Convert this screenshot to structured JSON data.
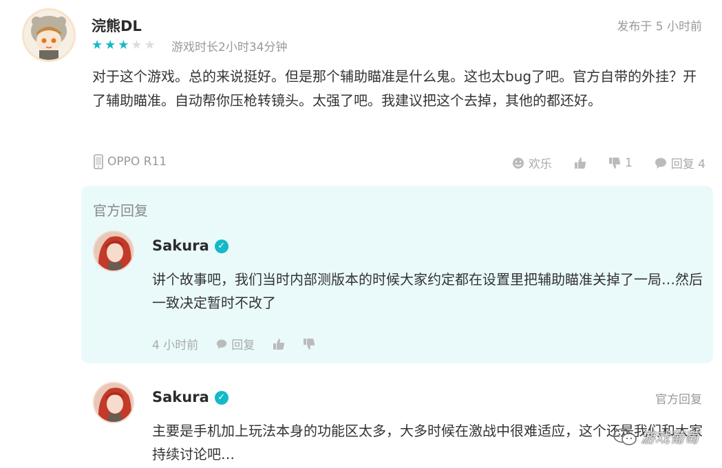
{
  "review": {
    "username": "浣熊DL",
    "rating": 3,
    "max_rating": 5,
    "playtime": "游戏时长2小时34分钟",
    "posted": "发布于 5 小时前",
    "text": "对于这个游戏。总的来说挺好。但是那个辅助瞄准是什么鬼。这也太bug了吧。官方自带的外挂？开了辅助瞄准。自动帮你压枪转镜头。太强了吧。我建议把这个去掉，其他的都还好。",
    "device": "OPPO R11",
    "actions": {
      "funny_label": "欢乐",
      "dislike_count": "1",
      "reply_label": "回复 4"
    }
  },
  "official_reply": {
    "section_label": "官方回复",
    "author": "Sakura",
    "text": "讲个故事吧，我们当时内部测版本的时候大家约定都在设置里把辅助瞄准关掉了一局…然后一致决定暂时不改了",
    "time": "4 小时前",
    "reply_label": "回复"
  },
  "second_reply": {
    "author": "Sakura",
    "tag": "官方回复",
    "text": "主要是手机加上玩法本身的功能区太多，大多时候在激战中很难适应，这个还是我们和大家持续讨论吧…"
  },
  "watermark": "游戏葡萄",
  "colors": {
    "accent": "#14b9c8",
    "panel_bg": "#eafafb",
    "muted": "#999999"
  }
}
